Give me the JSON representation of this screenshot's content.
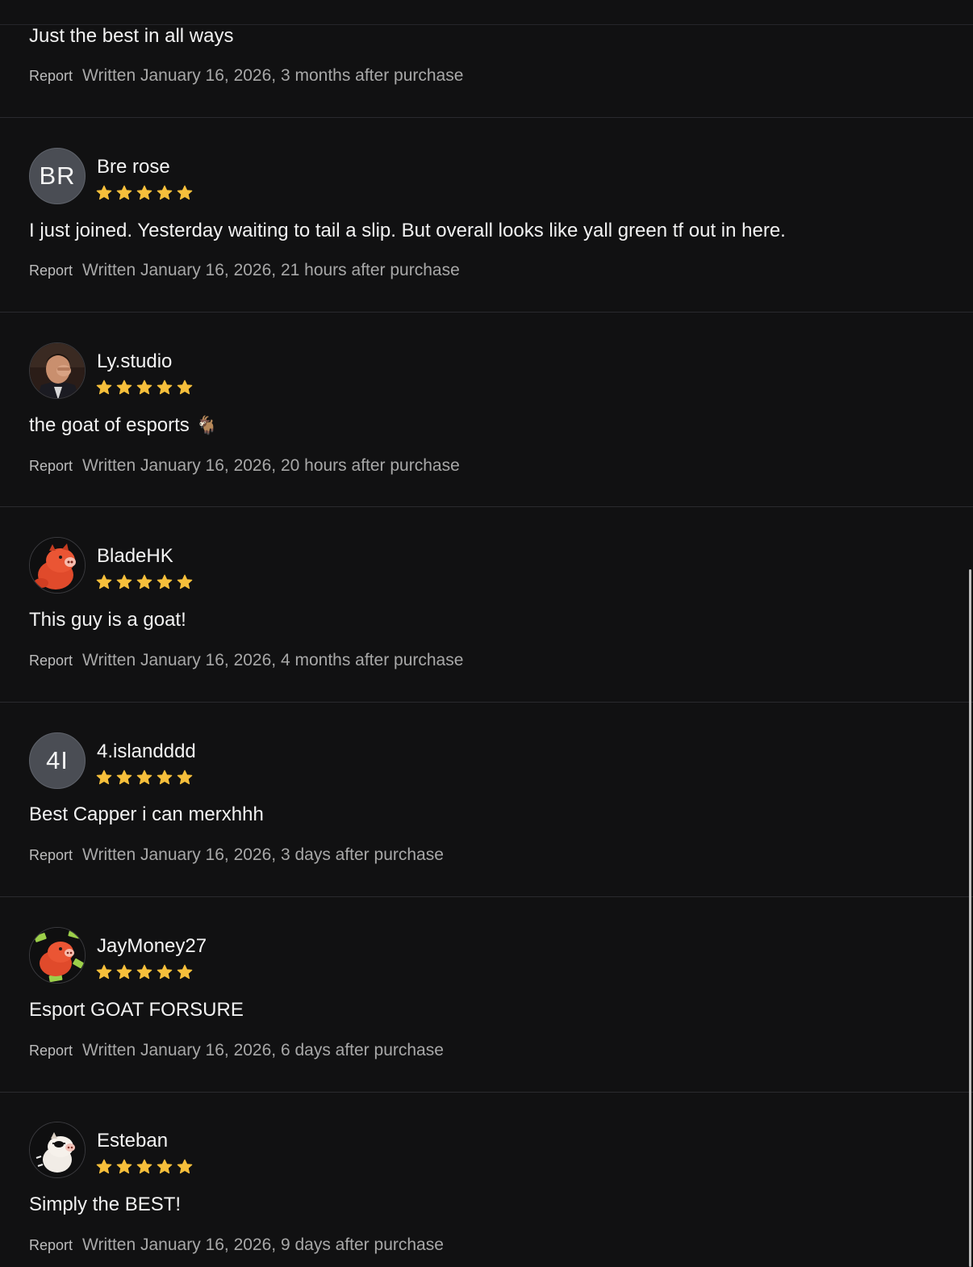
{
  "colors": {
    "background": "#111112",
    "divider": "#2a2a2e",
    "star": "#f6bf3b",
    "avatar_initials_bg": "#4a4d54",
    "meta_text": "#a8a8a8"
  },
  "reviews": [
    {
      "body": "Just the best in all ways",
      "report_label": "Report",
      "written": "Written January 16, 2026, 3 months after purchase"
    },
    {
      "initials": "BR",
      "name": "Bre rose",
      "rating": 5,
      "body": "I just joined. Yesterday waiting to tail a slip. But overall looks like yall green tf out in here.",
      "report_label": "Report",
      "written": "Written January 16, 2026, 21 hours after purchase"
    },
    {
      "avatar_icon": "person-photo-avatar",
      "name": "Ly.studio",
      "rating": 5,
      "body": "the goat of esports",
      "body_emoji": "🐐",
      "report_label": "Report",
      "written": "Written January 16, 2026, 20 hours after purchase"
    },
    {
      "avatar_icon": "red-pig-avatar",
      "name": "BladeHK",
      "rating": 5,
      "body": "This guy is a goat!",
      "report_label": "Report",
      "written": "Written January 16, 2026, 4 months after purchase"
    },
    {
      "initials": "4I",
      "name": "4.islandddd",
      "rating": 5,
      "body": "Best Capper i can merxhhh",
      "report_label": "Report",
      "written": "Written January 16, 2026, 3 days after purchase"
    },
    {
      "avatar_icon": "red-pig-money-avatar",
      "name": "JayMoney27",
      "rating": 5,
      "body": "Esport GOAT FORSURE",
      "report_label": "Report",
      "written": "Written January 16, 2026, 6 days after purchase"
    },
    {
      "avatar_icon": "white-pig-sunglasses-avatar",
      "name": "Esteban",
      "rating": 5,
      "body": "Simply the BEST!",
      "report_label": "Report",
      "written": "Written January 16, 2026, 9 days after purchase"
    }
  ]
}
